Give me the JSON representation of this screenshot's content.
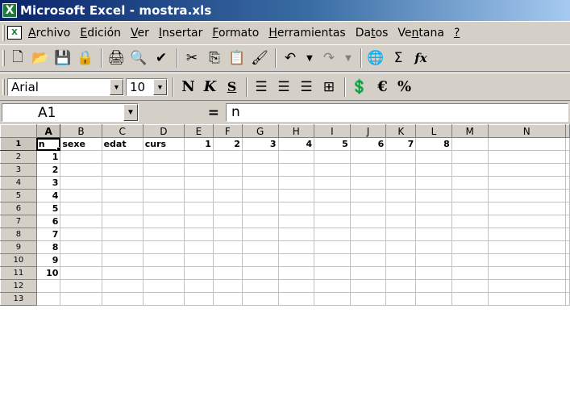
{
  "window": {
    "title": "Microsoft Excel - mostra.xls",
    "app_icon": "X"
  },
  "menu": {
    "items": [
      {
        "label": "Archivo",
        "accel": "A",
        "rest": "rchivo"
      },
      {
        "label": "Edición",
        "accel": "E",
        "rest": "dición"
      },
      {
        "label": "Ver",
        "accel": "V",
        "rest": "er"
      },
      {
        "label": "Insertar",
        "accel": "I",
        "rest": "nsertar"
      },
      {
        "label": "Formato",
        "accel": "F",
        "rest": "ormato"
      },
      {
        "label": "Herramientas",
        "accel": "H",
        "rest": "erramientas"
      },
      {
        "label": "Datos",
        "pre": "Da",
        "accel": "t",
        "rest": "os"
      },
      {
        "label": "Ventana",
        "pre": "Ve",
        "accel": "n",
        "rest": "tana"
      },
      {
        "label": "?",
        "accel": "?",
        "rest": ""
      }
    ]
  },
  "standard_toolbar": {
    "icons": [
      "new-icon",
      "open-icon",
      "save-icon",
      "permission-icon",
      "print-icon",
      "print-preview-icon",
      "spelling-icon",
      "cut-icon",
      "copy-icon",
      "paste-icon",
      "format-painter-icon",
      "undo-icon",
      "redo-icon",
      "hyperlink-icon",
      "autosum-icon",
      "function-icon"
    ],
    "glyphs": {
      "autosum": "Σ",
      "function": "fx"
    }
  },
  "format_toolbar": {
    "font": "Arial",
    "size": "10",
    "bold": "N",
    "italic": "K",
    "underline": "S",
    "euro": "€",
    "percent": "%"
  },
  "formula_bar": {
    "name_box": "A1",
    "equals": "=",
    "content": "n"
  },
  "grid": {
    "columns": [
      "A",
      "B",
      "C",
      "D",
      "E",
      "F",
      "G",
      "H",
      "I",
      "J",
      "K",
      "L",
      "M",
      "N"
    ],
    "active_column": "A",
    "rows": [
      [
        "1",
        [
          "n",
          "sexe",
          "edat",
          "curs",
          "1",
          "2",
          "3",
          "4",
          "5",
          "6",
          "7",
          "8",
          "",
          ""
        ]
      ],
      [
        "2",
        [
          "1",
          "",
          "",
          "",
          "",
          "",
          "",
          "",
          "",
          "",
          "",
          "",
          "",
          ""
        ]
      ],
      [
        "3",
        [
          "2",
          "",
          "",
          "",
          "",
          "",
          "",
          "",
          "",
          "",
          "",
          "",
          "",
          ""
        ]
      ],
      [
        "4",
        [
          "3",
          "",
          "",
          "",
          "",
          "",
          "",
          "",
          "",
          "",
          "",
          "",
          "",
          ""
        ]
      ],
      [
        "5",
        [
          "4",
          "",
          "",
          "",
          "",
          "",
          "",
          "",
          "",
          "",
          "",
          "",
          "",
          ""
        ]
      ],
      [
        "6",
        [
          "5",
          "",
          "",
          "",
          "",
          "",
          "",
          "",
          "",
          "",
          "",
          "",
          "",
          ""
        ]
      ],
      [
        "7",
        [
          "6",
          "",
          "",
          "",
          "",
          "",
          "",
          "",
          "",
          "",
          "",
          "",
          "",
          ""
        ]
      ],
      [
        "8",
        [
          "7",
          "",
          "",
          "",
          "",
          "",
          "",
          "",
          "",
          "",
          "",
          "",
          "",
          ""
        ]
      ],
      [
        "9",
        [
          "8",
          "",
          "",
          "",
          "",
          "",
          "",
          "",
          "",
          "",
          "",
          "",
          "",
          ""
        ]
      ],
      [
        "10",
        [
          "9",
          "",
          "",
          "",
          "",
          "",
          "",
          "",
          "",
          "",
          "",
          "",
          "",
          ""
        ]
      ],
      [
        "11",
        [
          "10",
          "",
          "",
          "",
          "",
          "",
          "",
          "",
          "",
          "",
          "",
          "",
          "",
          ""
        ]
      ],
      [
        "12",
        [
          "",
          "",
          "",
          "",
          "",
          "",
          "",
          "",
          "",
          "",
          "",
          "",
          "",
          ""
        ]
      ],
      [
        "13",
        [
          "",
          "",
          "",
          "",
          "",
          "",
          "",
          "",
          "",
          "",
          "",
          "",
          "",
          ""
        ]
      ]
    ]
  },
  "colors": {
    "title_start": "#0a246a",
    "title_end": "#a6caf0",
    "chrome": "#d4d0c8"
  }
}
